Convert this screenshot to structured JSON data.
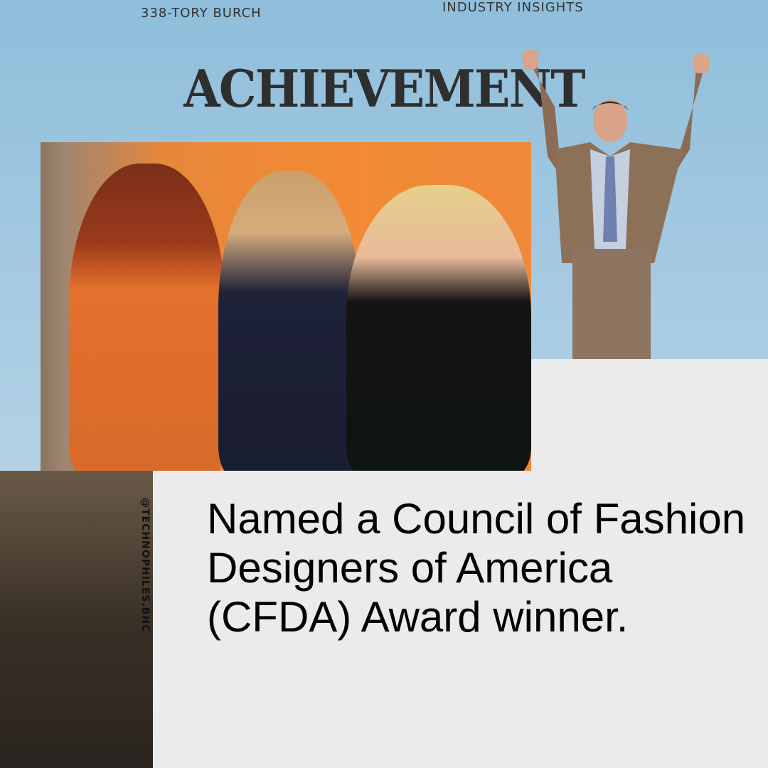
{
  "header": {
    "series": "338-TORY BURCH",
    "category": "INDUSTRY INSIGHTS"
  },
  "title": "ACHIEVEMENT",
  "handle": "@TECHNOPHILES.BHC",
  "body": "Named a Council of Fashion Designers of America (CFDA) Award winner.",
  "colors": {
    "panel": "#ebebeb",
    "title": "#2f2f2f",
    "backdrop": "#f28a35"
  }
}
